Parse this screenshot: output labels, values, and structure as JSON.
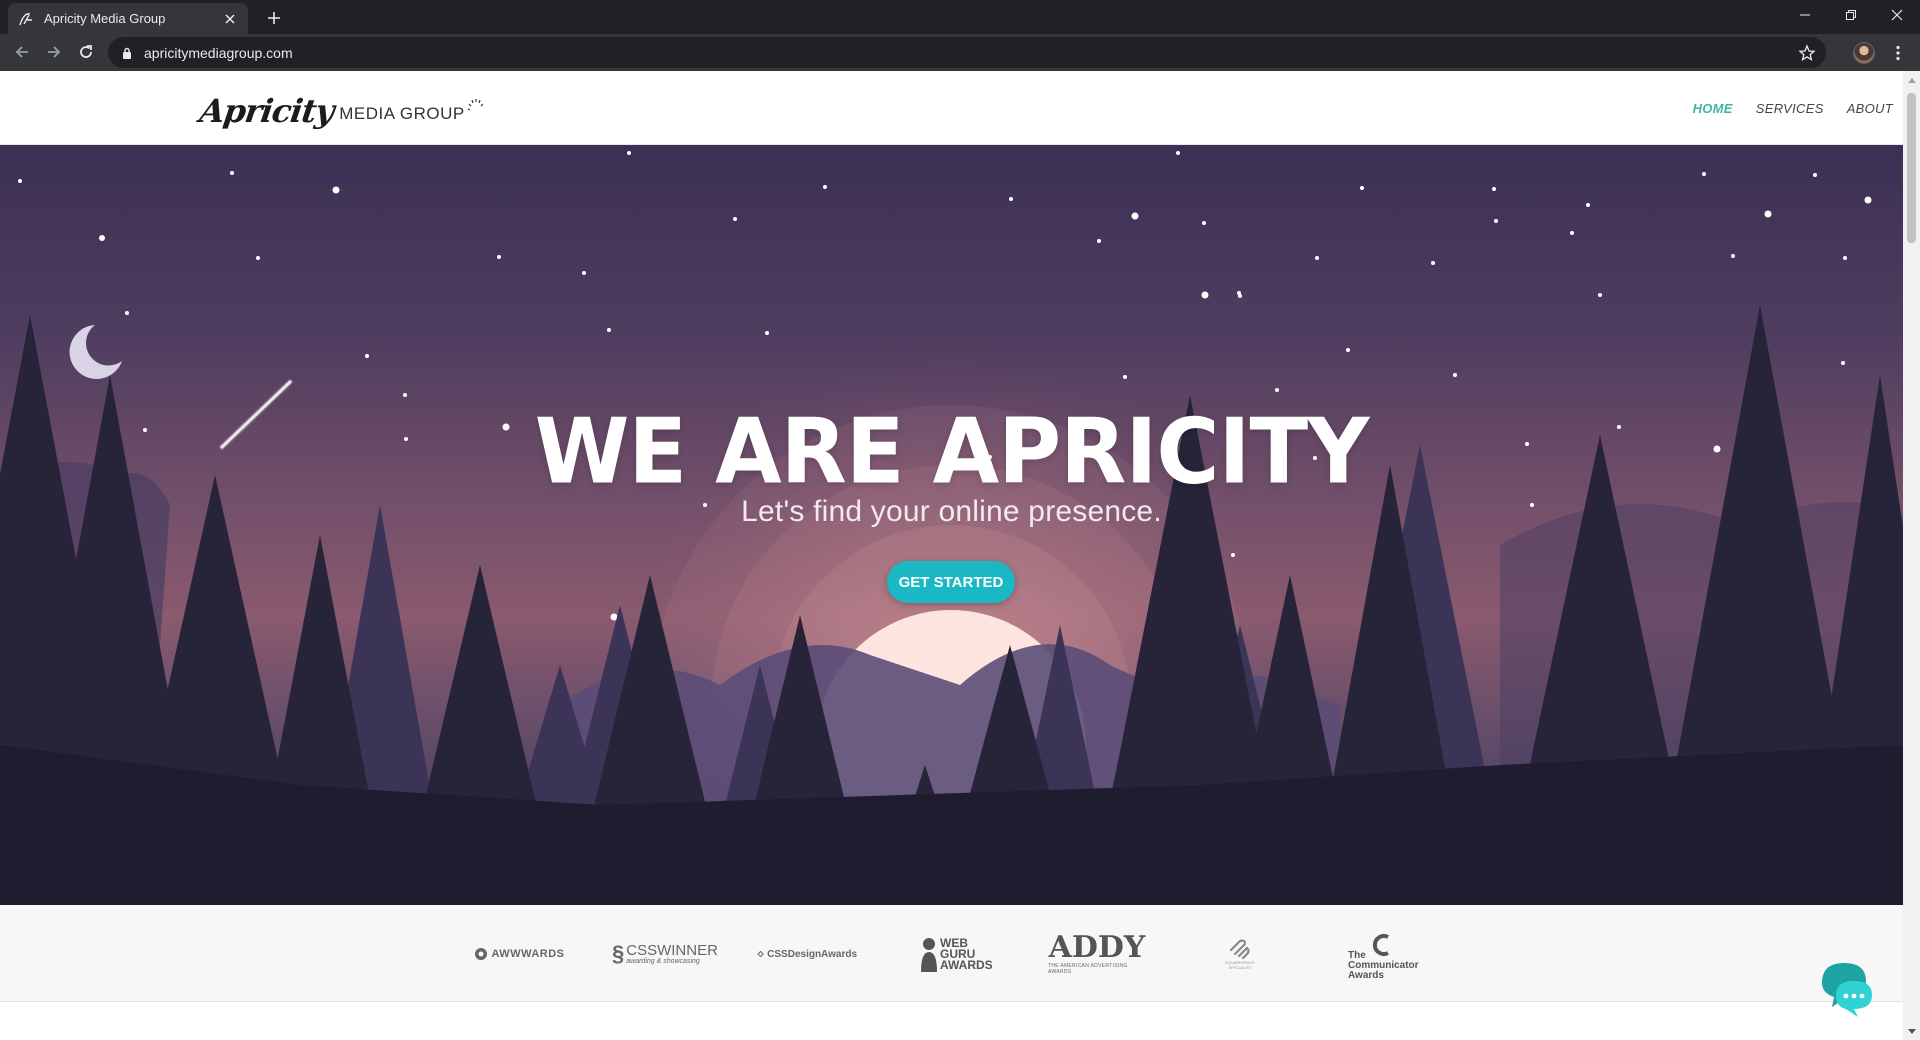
{
  "browser": {
    "tab_title": "Apricity Media Group",
    "url": "apricitymediagroup.com"
  },
  "site": {
    "logo_script": "Apricity",
    "logo_sub": "MEDIA GROUP",
    "nav": [
      {
        "label": "HOME",
        "active": true
      },
      {
        "label": "SERVICES",
        "active": false
      },
      {
        "label": "ABOUT",
        "active": false
      }
    ]
  },
  "hero": {
    "title": "WE ARE APRICITY",
    "subtitle": "Let's find your online presence.",
    "cta_label": "GET STARTED"
  },
  "awards": [
    {
      "name": "AWWWARDS",
      "icon": "awwwards-logo"
    },
    {
      "name": "CSSWINNER",
      "tagline": "awarding & showcasing",
      "icon": "csswinner-logo"
    },
    {
      "name": "CSSDesignAwards",
      "icon": "cssdesignawards-logo"
    },
    {
      "name": "WEB GURU AWARDS",
      "icon": "webguru-logo"
    },
    {
      "name": "ADDY",
      "tagline": "THE AMERICAN ADVERTISING AWARDS",
      "icon": "addy-logo"
    },
    {
      "name": "SQUARESPACE",
      "tagline": "SPECIALIST",
      "icon": "squarespace-logo"
    },
    {
      "name": "The Communicator Awards",
      "icon": "communicator-logo"
    }
  ],
  "colors": {
    "accent": "#3fb5a4",
    "cta": "#1ab8c4",
    "chat": "#1fc7c7"
  }
}
